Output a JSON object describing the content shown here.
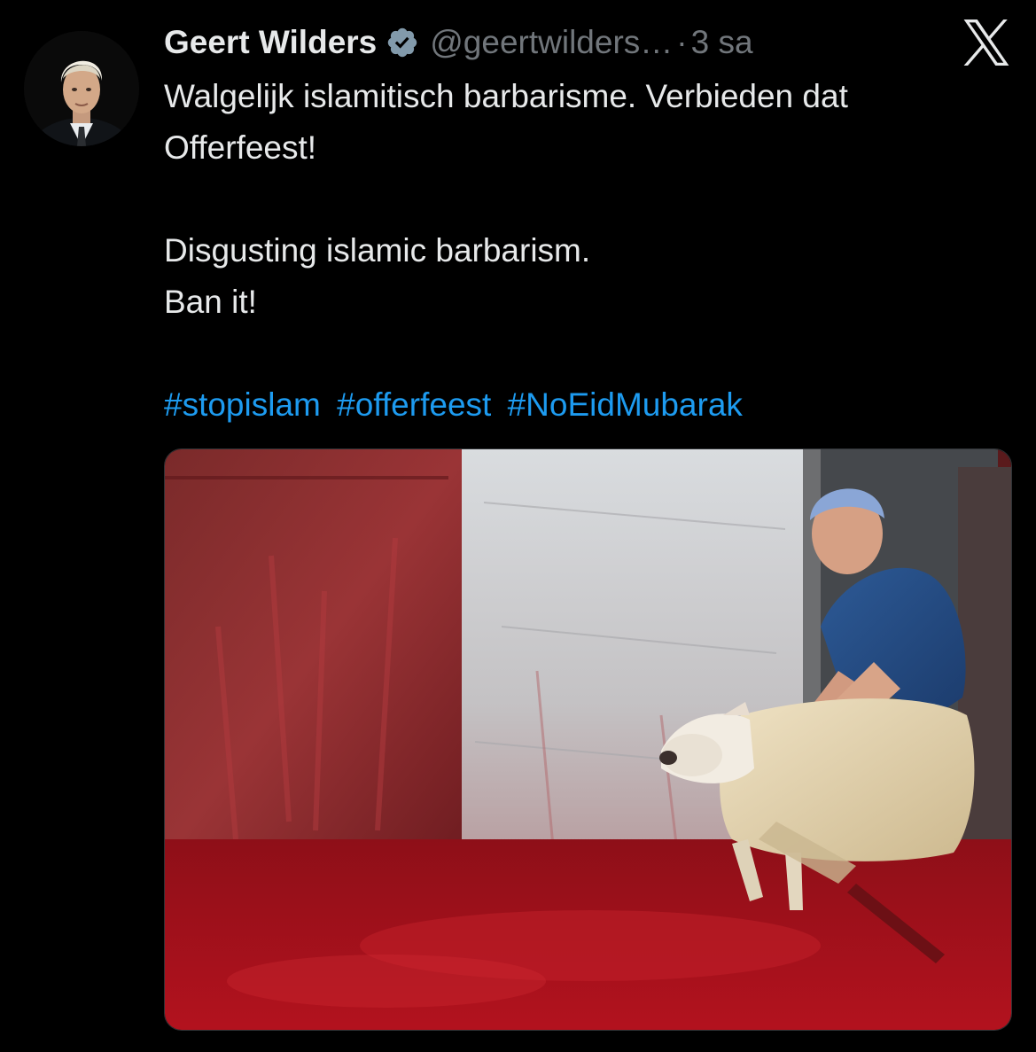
{
  "tweet": {
    "author_name": "Geert Wilders",
    "handle": "@geertwilders…",
    "separator": "·",
    "time": "3 sa",
    "text_lines": [
      "Walgelijk islamitisch barbarisme. Verbieden dat",
      "Offerfeest!",
      "",
      "Disgusting islamic barbarism.",
      "Ban it!",
      ""
    ],
    "hashtags": [
      "#stopislam",
      "#offerfeest",
      "#NoEidMubarak"
    ]
  },
  "icons": {
    "verified": "verified-badge-icon",
    "platform": "x-logo-icon"
  },
  "colors": {
    "background": "#000000",
    "text": "#e7e9ea",
    "secondary_text": "#71767b",
    "link": "#1d9bf0",
    "verified_badge": "#829aab"
  }
}
